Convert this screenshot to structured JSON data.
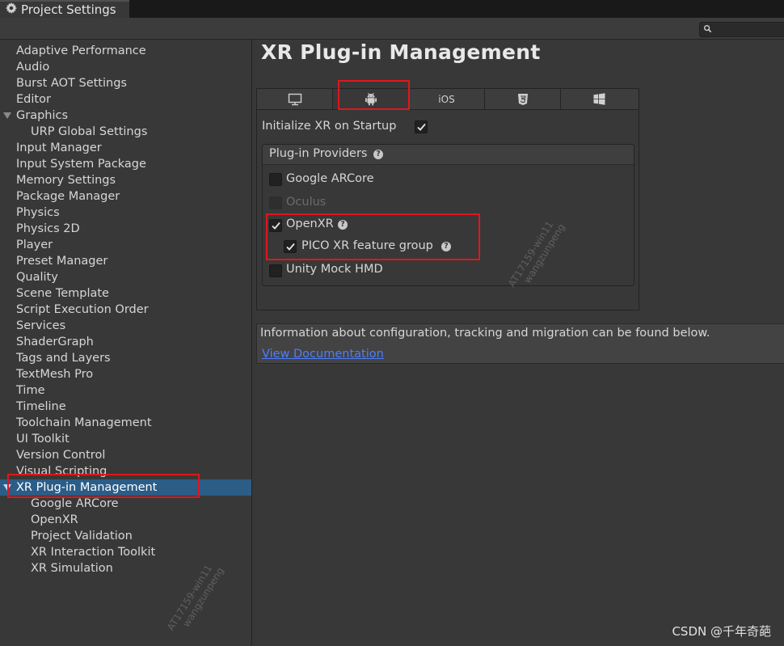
{
  "window": {
    "tab_title": "Project Settings",
    "tab_icon": "gear-icon"
  },
  "toolbar": {
    "search_placeholder": "",
    "search_icon": "search-icon"
  },
  "sidebar": {
    "items": [
      {
        "label": "Adaptive Performance",
        "level": 0,
        "expanded": null,
        "selected": false
      },
      {
        "label": "Audio",
        "level": 0,
        "expanded": null,
        "selected": false
      },
      {
        "label": "Burst AOT Settings",
        "level": 0,
        "expanded": null,
        "selected": false
      },
      {
        "label": "Editor",
        "level": 0,
        "expanded": null,
        "selected": false
      },
      {
        "label": "Graphics",
        "level": 0,
        "expanded": true,
        "selected": false
      },
      {
        "label": "URP Global Settings",
        "level": 1,
        "expanded": null,
        "selected": false
      },
      {
        "label": "Input Manager",
        "level": 0,
        "expanded": null,
        "selected": false
      },
      {
        "label": "Input System Package",
        "level": 0,
        "expanded": null,
        "selected": false
      },
      {
        "label": "Memory Settings",
        "level": 0,
        "expanded": null,
        "selected": false
      },
      {
        "label": "Package Manager",
        "level": 0,
        "expanded": null,
        "selected": false
      },
      {
        "label": "Physics",
        "level": 0,
        "expanded": null,
        "selected": false
      },
      {
        "label": "Physics 2D",
        "level": 0,
        "expanded": null,
        "selected": false
      },
      {
        "label": "Player",
        "level": 0,
        "expanded": null,
        "selected": false
      },
      {
        "label": "Preset Manager",
        "level": 0,
        "expanded": null,
        "selected": false
      },
      {
        "label": "Quality",
        "level": 0,
        "expanded": null,
        "selected": false
      },
      {
        "label": "Scene Template",
        "level": 0,
        "expanded": null,
        "selected": false
      },
      {
        "label": "Script Execution Order",
        "level": 0,
        "expanded": null,
        "selected": false
      },
      {
        "label": "Services",
        "level": 0,
        "expanded": null,
        "selected": false
      },
      {
        "label": "ShaderGraph",
        "level": 0,
        "expanded": null,
        "selected": false
      },
      {
        "label": "Tags and Layers",
        "level": 0,
        "expanded": null,
        "selected": false
      },
      {
        "label": "TextMesh Pro",
        "level": 0,
        "expanded": null,
        "selected": false
      },
      {
        "label": "Time",
        "level": 0,
        "expanded": null,
        "selected": false
      },
      {
        "label": "Timeline",
        "level": 0,
        "expanded": null,
        "selected": false
      },
      {
        "label": "Toolchain Management",
        "level": 0,
        "expanded": null,
        "selected": false
      },
      {
        "label": "UI Toolkit",
        "level": 0,
        "expanded": null,
        "selected": false
      },
      {
        "label": "Version Control",
        "level": 0,
        "expanded": null,
        "selected": false
      },
      {
        "label": "Visual Scripting",
        "level": 0,
        "expanded": null,
        "selected": false
      },
      {
        "label": "XR Plug-in Management",
        "level": 0,
        "expanded": true,
        "selected": true
      },
      {
        "label": "Google ARCore",
        "level": 1,
        "expanded": null,
        "selected": false
      },
      {
        "label": "OpenXR",
        "level": 1,
        "expanded": null,
        "selected": false
      },
      {
        "label": "Project Validation",
        "level": 1,
        "expanded": null,
        "selected": false
      },
      {
        "label": "XR Interaction Toolkit",
        "level": 1,
        "expanded": null,
        "selected": false
      },
      {
        "label": "XR Simulation",
        "level": 1,
        "expanded": null,
        "selected": false
      }
    ]
  },
  "main": {
    "title": "XR Plug-in Management",
    "platform_tabs": [
      {
        "icon": "monitor-icon",
        "label": "",
        "active": false
      },
      {
        "icon": "android-icon",
        "label": "",
        "active": true
      },
      {
        "icon": "",
        "label": "iOS",
        "active": false
      },
      {
        "icon": "html5-icon",
        "label": "",
        "active": false
      },
      {
        "icon": "windows-icon",
        "label": "",
        "active": false
      }
    ],
    "initialize_label": "Initialize XR on Startup",
    "initialize_checked": true,
    "providers_title": "Plug-in Providers",
    "providers": [
      {
        "label": "Google ARCore",
        "checked": false,
        "enabled": true,
        "help": false
      },
      {
        "label": "Oculus",
        "checked": false,
        "enabled": false,
        "help": false
      },
      {
        "label": "OpenXR",
        "checked": true,
        "enabled": true,
        "help": true
      },
      {
        "label": "PICO XR feature group",
        "checked": true,
        "enabled": true,
        "help": true
      },
      {
        "label": "Unity Mock HMD",
        "checked": false,
        "enabled": true,
        "help": false
      }
    ],
    "info_text": "Information about configuration, tracking and migration can be found below.",
    "doc_link": "View Documentation"
  },
  "annotations": {
    "highlight_color": "#e0161d"
  },
  "watermarks": [
    "AT17159-win11",
    "wangzunpeng"
  ],
  "credit": "CSDN @千年奇葩",
  "colors": {
    "selection": "#2c5d87",
    "link": "#4c7eff",
    "background": "#383838"
  }
}
